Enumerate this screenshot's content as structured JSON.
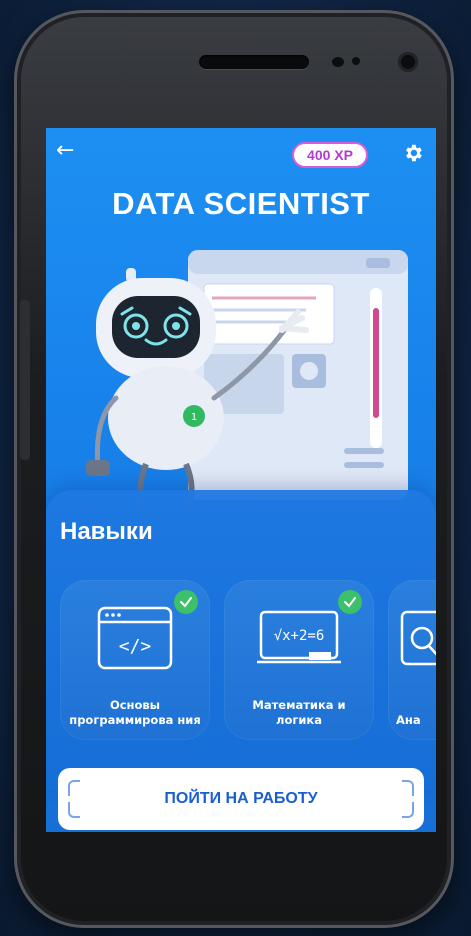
{
  "header": {
    "back_icon": "arrow-left-icon",
    "xp_badge": "400 XP",
    "settings_icon": "gear-icon",
    "title": "DATA SCIENTIST"
  },
  "skills": {
    "heading": "Навыки",
    "cards": [
      {
        "label": "Основы программирова ния",
        "icon": "code-window-icon",
        "completed": true
      },
      {
        "label": "Математика и логика",
        "icon": "math-board-icon",
        "icon_text": "√x+2=6",
        "completed": true
      },
      {
        "label": "Ана",
        "icon": "analytics-icon",
        "completed": false
      }
    ]
  },
  "cta": {
    "label": "ПОЙТИ НА РАБОТУ"
  },
  "colors": {
    "screen_blue": "#1a88ee",
    "check_green": "#3cc06a",
    "xp_text": "#b33ad1",
    "cta_text": "#1a5fd0"
  }
}
